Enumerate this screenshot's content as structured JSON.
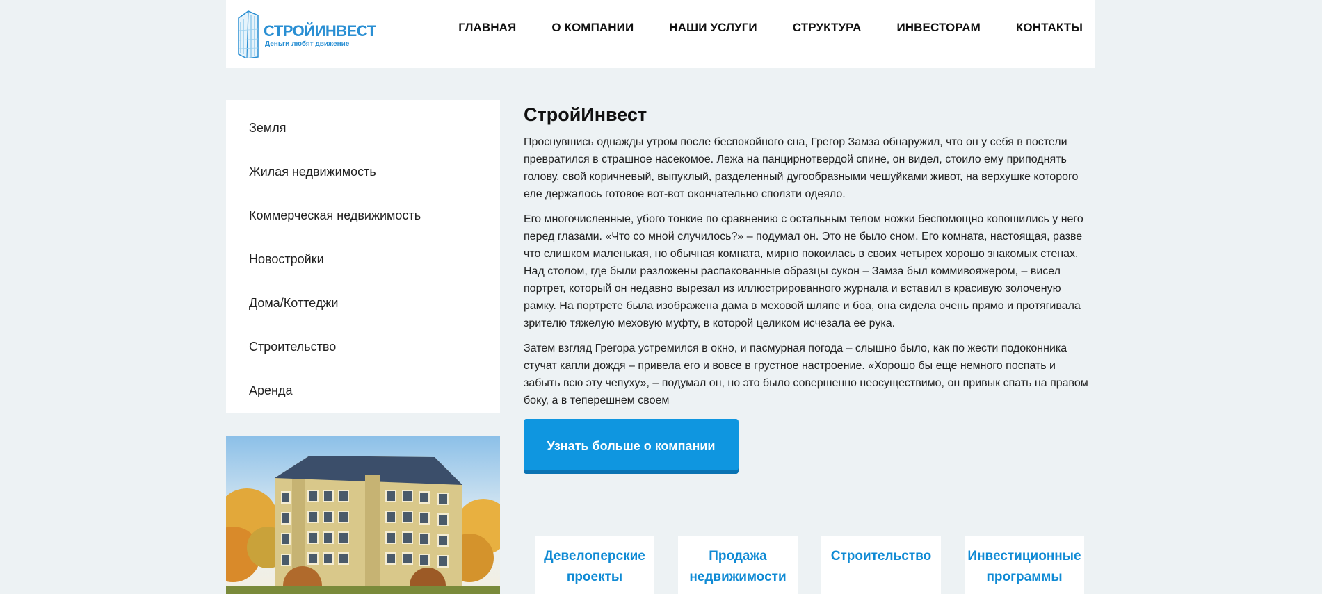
{
  "header": {
    "logo": {
      "title": "СТРОЙИНВЕСТ",
      "slogan": "Деньги любят движение",
      "icon": "skyscraper-icon",
      "color": "#2a8fd3"
    },
    "nav": [
      "ГЛАВНАЯ",
      "О КОМПАНИИ",
      "НАШИ УСЛУГИ",
      "СТРУКТУРА",
      "ИНВЕСТОРАМ",
      "КОНТАКТЫ"
    ]
  },
  "sidebar": {
    "items": [
      "Земля",
      "Жилая недвижимость",
      "Коммерческая недвижимость",
      "Новостройки",
      "Дома/Коттеджи",
      "Строительство",
      "Аренда"
    ]
  },
  "main": {
    "title": "СтройИнвест",
    "paragraphs": [
      "Проснувшись однажды утром после беспокойного сна, Грегор Замза обнаружил, что он у себя в постели превратился в страшное насекомое. Лежа на панцирнотвердой спине, он видел, стоило ему приподнять голову, свой коричневый, выпуклый, разделенный дугообразными чешуйками живот, на верхушке которого еле держалось готовое вот-вот окончательно сползти одеяло.",
      "Его многочисленные, убого тонкие по сравнению с остальным телом ножки беспомощно копошились у него перед глазами. «Что со мной случилось?» – подумал он. Это не было сном. Его комната, настоящая, разве что слишком маленькая, но обычная комната, мирно покоилась в своих четырех хорошо знакомых стенах. Над столом, где были разложены распакованные образцы сукон – Замза был коммивояжером, – висел портрет, который он недавно вырезал из иллюстрированного журнала и вставил в красивую золоченую рамку. На портрете была изображена дама в меховой шляпе и боа, она сидела очень прямо и протягивала зрителю тяжелую меховую муфту, в которой целиком исчезала ее рука.",
      "Затем взгляд Грегора устремился в окно, и пасмурная погода – слышно было, как по жести подоконника стучат капли дождя – привела его и вовсе в грустное настроение. «Хорошо бы еще немного поспать и забыть всю эту чепуху», – подумал он, но это было совершенно неосуществимо, он привык спать на правом боку, а в теперешнем своем"
    ],
    "more_button": "Узнать больше о компании"
  },
  "services": [
    [
      "Девелоперские",
      "проекты"
    ],
    [
      "Продажа",
      "недвижимости"
    ],
    [
      "Строительство",
      ""
    ],
    [
      "Инвестиционные",
      "программы"
    ]
  ],
  "colors": {
    "accent": "#0f96e0",
    "card_text": "#0f8ad4",
    "background": "#edf2f4"
  }
}
